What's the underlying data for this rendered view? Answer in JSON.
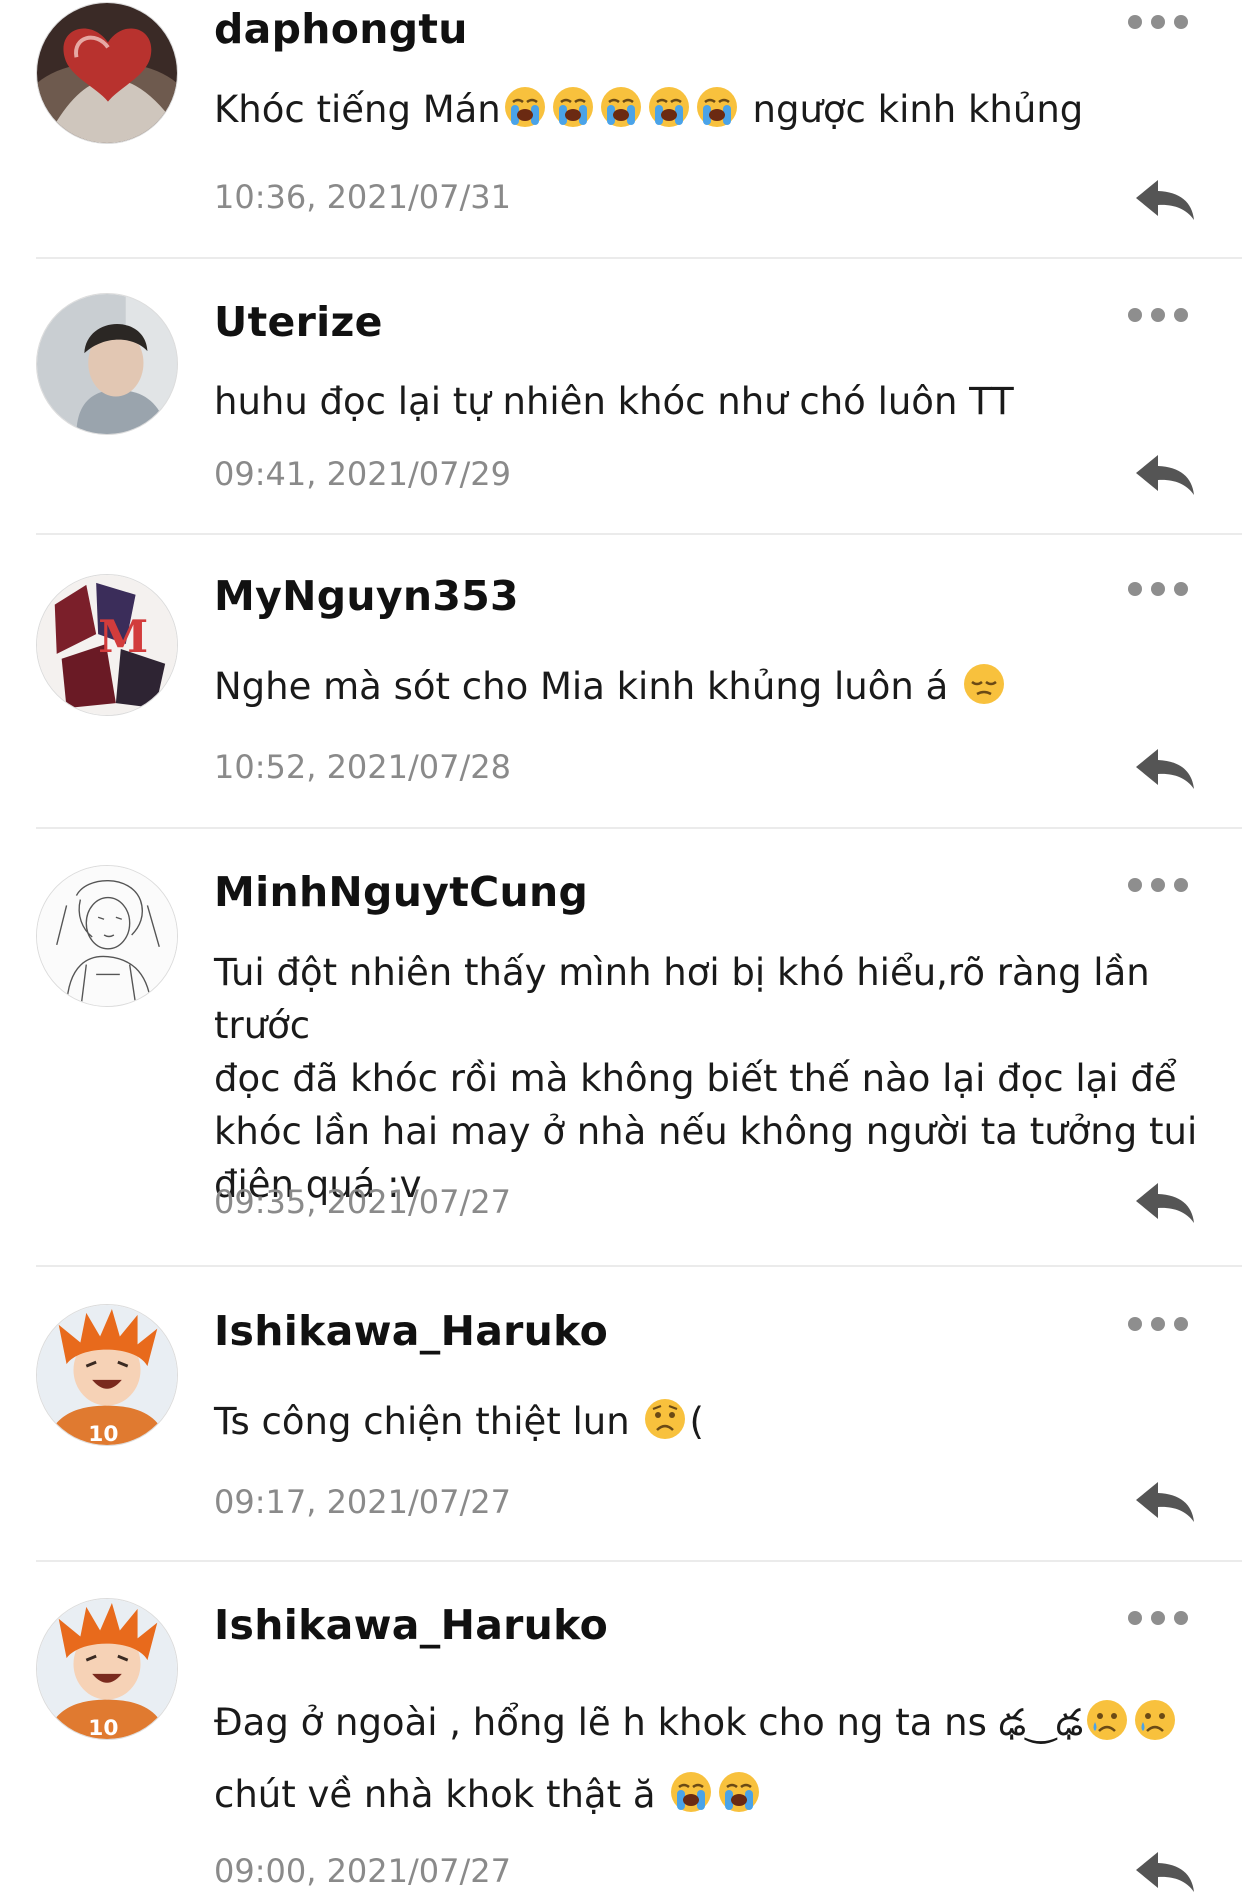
{
  "comments": [
    {
      "username": "daphongtu",
      "text_before": "Khóc tiếng Mán",
      "text_after": " ngược kinh khủng",
      "timestamp": "10:36, 2021/07/31",
      "avatar": "heart-book-avatar"
    },
    {
      "username": "Uterize",
      "text": "huhu đọc lại tự nhiên khóc như chó luôn TT",
      "timestamp": "09:41, 2021/07/29",
      "avatar": "boy-photo-avatar"
    },
    {
      "username": "MyNguyn353",
      "text": "Nghe mà sót cho Mia kinh khủng luôn á",
      "timestamp": "10:52, 2021/07/28",
      "avatar": "anime-group-avatar"
    },
    {
      "username": "MinhNguytCung",
      "lines": [
        "Tui đột nhiên thấy mình hơi bị khó hiểu,rõ ràng lần trước",
        "đọc đã khóc rồi mà không biết thế nào lại đọc lại để",
        "khóc lần hai may ở nhà nếu không người ta tưởng tui",
        "điên quá :v"
      ],
      "timestamp": "09:35, 2021/07/27",
      "avatar": "sketch-avatar"
    },
    {
      "username": "Ishikawa_Haruko",
      "text_before": "Ts công chiện thiệt lun ",
      "text_after": "(",
      "timestamp": "09:17, 2021/07/27",
      "avatar": "orange-hair-anime-avatar"
    },
    {
      "username": "Ishikawa_Haruko",
      "line1": "Đag ở ngoài , hổng lẽ h khok cho ng ta ns ",
      "glyphs": "ఢ‿ఢ",
      "line2": "chút về nhà khok thật ă ",
      "timestamp": "09:00, 2021/07/27",
      "avatar": "orange-hair-anime-avatar"
    }
  ],
  "icons": {
    "more": "more-options-icon",
    "reply": "reply-arrow-icon",
    "emoji_loudly_crying": "loudly-crying-face-emoji",
    "emoji_pensive": "pensive-face-emoji",
    "emoji_worried": "worried-face-emoji",
    "emoji_crying": "crying-face-emoji"
  },
  "colors": {
    "username": "#111111",
    "timestamp": "#8a8a8a",
    "icon": "#555555",
    "divider": "#ebebeb"
  }
}
